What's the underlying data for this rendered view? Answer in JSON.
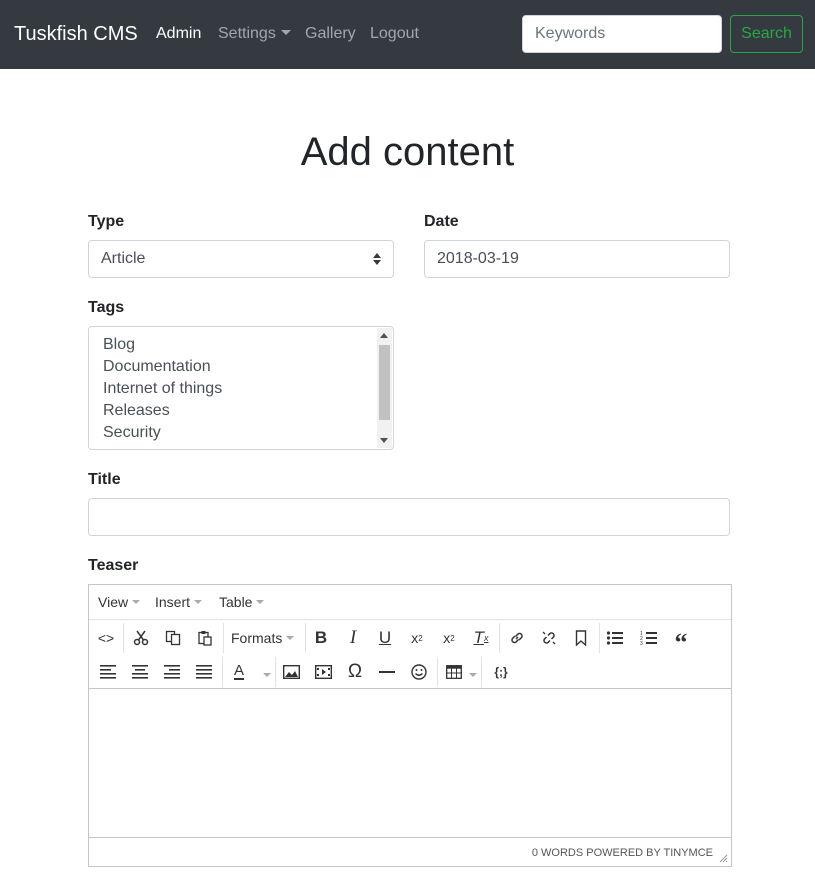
{
  "navbar": {
    "brand": "Tuskfish CMS",
    "links": [
      {
        "label": "Admin",
        "active": true
      },
      {
        "label": "Settings",
        "dropdown": true
      },
      {
        "label": "Gallery"
      },
      {
        "label": "Logout"
      }
    ],
    "search": {
      "placeholder": "Keywords",
      "value": "",
      "button_label": "Search"
    }
  },
  "page": {
    "title": "Add content"
  },
  "form": {
    "type": {
      "label": "Type",
      "selected": "Article"
    },
    "date": {
      "label": "Date",
      "value": "2018-03-19"
    },
    "tags": {
      "label": "Tags",
      "options": [
        "Blog",
        "Documentation",
        "Internet of things",
        "Releases",
        "Security"
      ]
    },
    "title": {
      "label": "Title",
      "value": ""
    },
    "teaser": {
      "label": "Teaser",
      "menubar": [
        "View",
        "Insert",
        "Table"
      ],
      "formats_label": "Formats",
      "status": "0 WORDS POWERED BY TINYMCE"
    }
  },
  "colors": {
    "navbar_bg": "#343a40",
    "search_button": "#28a745",
    "input_border": "#ced4da"
  }
}
